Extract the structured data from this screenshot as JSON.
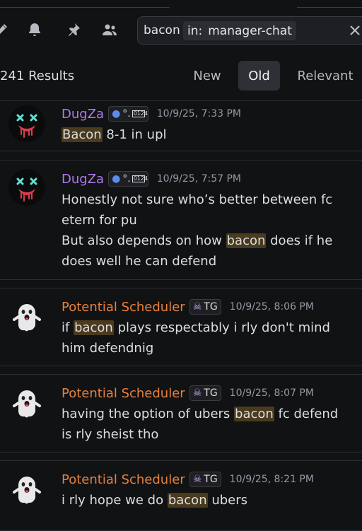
{
  "toolbar": {
    "icons": [
      "threads-icon",
      "bell-icon",
      "pin-icon",
      "members-icon"
    ],
    "search": {
      "term": "bacon",
      "filter_key": "in:",
      "filter_value": "manager-chat"
    }
  },
  "results": {
    "count_label": "241 Results",
    "sort_tabs": [
      {
        "label": "New",
        "active": false
      },
      {
        "label": "Old",
        "active": true
      },
      {
        "label": "Relevant",
        "active": false
      }
    ]
  },
  "messages": [
    {
      "author": "DugZa",
      "author_color": "#b179f1",
      "tag_text": "°.",
      "tag_glyph": "0124",
      "timestamp": "10/9/25, 7:33 PM",
      "avatar": "skull-avatar",
      "lines": [
        {
          "before": "",
          "highlight": "Bacon",
          "after": " 8-1 in upl"
        }
      ]
    },
    {
      "author": "DugZa",
      "author_color": "#b179f1",
      "tag_text": "°.",
      "tag_glyph": "0124",
      "timestamp": "10/9/25, 7:57 PM",
      "avatar": "skull-avatar",
      "lines": [
        {
          "before": "Honestly not sure who’s better between fc etern for pu",
          "highlight": "",
          "after": ""
        },
        {
          "before": "But also depends on how ",
          "highlight": "bacon",
          "after": " does if he does well he can defend"
        }
      ]
    },
    {
      "author": "Potential Scheduler",
      "author_color": "#e6813d",
      "tag_text": "TG",
      "timestamp": "10/9/25, 8:06 PM",
      "avatar": "ghost-avatar",
      "lines": [
        {
          "before": "if ",
          "highlight": "bacon",
          "after": " plays respectably i rly don't mind him defendnig"
        }
      ]
    },
    {
      "author": "Potential Scheduler",
      "author_color": "#e6813d",
      "tag_text": "TG",
      "timestamp": "10/9/25, 8:07 PM",
      "avatar": "ghost-avatar",
      "lines": [
        {
          "before": "having the option of ubers ",
          "highlight": "bacon",
          "after": " fc defend is rly sheist tho"
        }
      ]
    },
    {
      "author": "Potential Scheduler",
      "author_color": "#e6813d",
      "tag_text": "TG",
      "timestamp": "10/9/25, 8:21 PM",
      "avatar": "ghost-avatar",
      "lines": [
        {
          "before": "i rly hope we do ",
          "highlight": "bacon",
          "after": " ubers"
        }
      ]
    }
  ]
}
